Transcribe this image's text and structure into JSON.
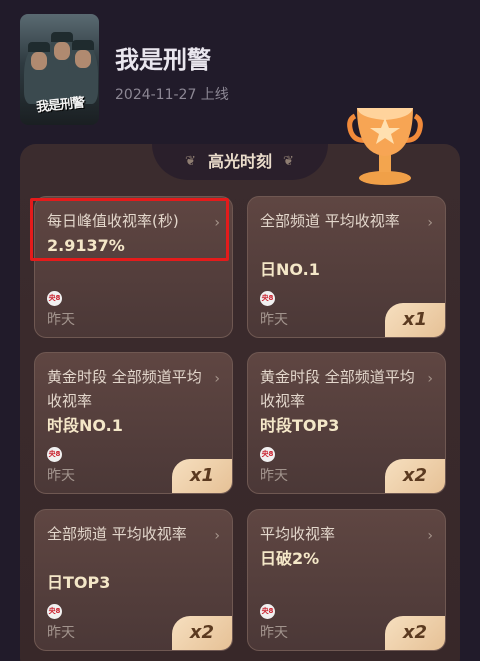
{
  "show": {
    "title": "我是刑警",
    "release": "2024-11-27 上线",
    "poster_logo": "我是刑警"
  },
  "section": {
    "title": "高光时刻",
    "left_ornament": "❦",
    "right_ornament": "❦"
  },
  "icons": {
    "chevron": "›",
    "channel_logo": "央8"
  },
  "cards": [
    {
      "label": "每日峰值收视率(秒)",
      "value": "2.9137%",
      "date": "昨天",
      "badge": ""
    },
    {
      "label": "全部频道 平均收视率",
      "value": "日NO.1",
      "date": "昨天",
      "badge": "x1"
    },
    {
      "label": "黄金时段 全部频道平均收视率",
      "value": "时段NO.1",
      "date": "昨天",
      "badge": "x1"
    },
    {
      "label": "黄金时段 全部频道平均收视率",
      "value": "时段TOP3",
      "date": "昨天",
      "badge": "x2"
    },
    {
      "label": "全部频道 平均收视率",
      "value": "日TOP3",
      "date": "昨天",
      "badge": "x2"
    },
    {
      "label": "平均收视率",
      "value": "日破2%",
      "date": "昨天",
      "badge": "x2"
    }
  ]
}
